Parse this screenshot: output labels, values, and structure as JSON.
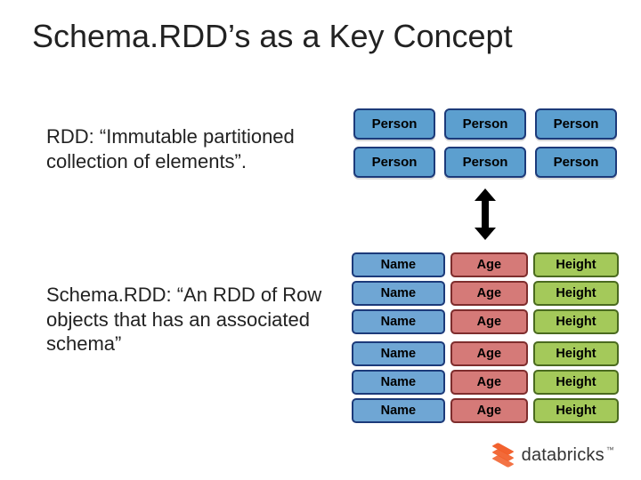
{
  "title": "Schema.RDD’s as a Key Concept",
  "paragraphs": {
    "rdd": "RDD: “Immutable partitioned collection of elements”.",
    "schema_rdd": "Schema.RDD: “An RDD of Row objects that has an associated schema”"
  },
  "diagram": {
    "person_label": "Person",
    "columns": {
      "name": "Name",
      "age": "Age",
      "height": "Height"
    }
  },
  "brand": {
    "name": "databricks",
    "tm": "™"
  }
}
